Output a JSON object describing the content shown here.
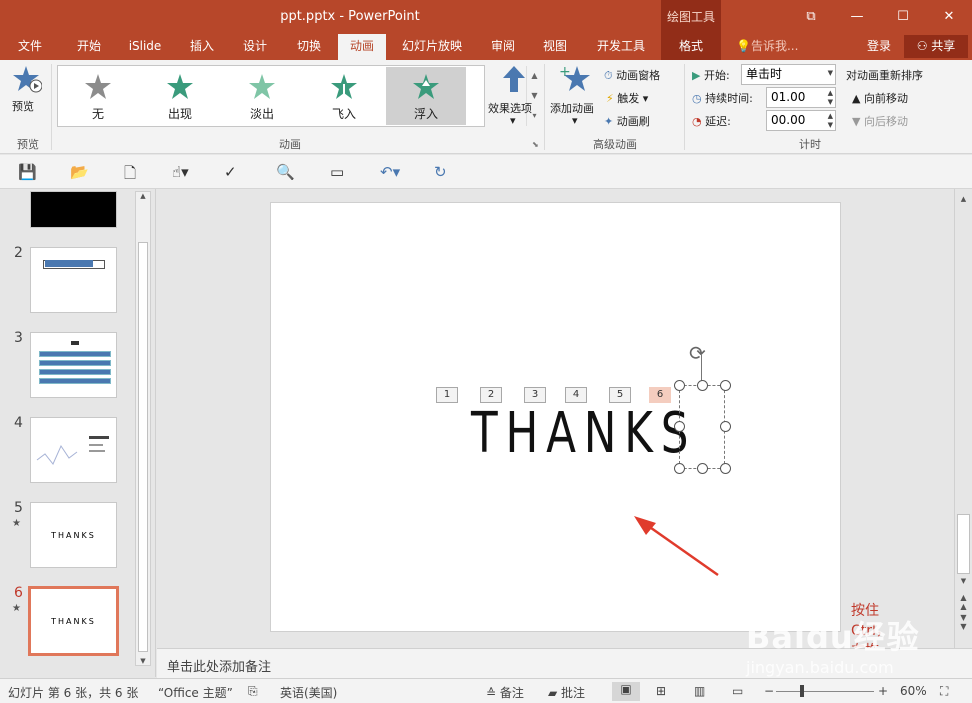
{
  "window": {
    "title": "ppt.pptx - PowerPoint",
    "context_tool": "绘图工具"
  },
  "tabs": [
    "文件",
    "开始",
    "iSlide",
    "插入",
    "设计",
    "切换",
    "动画",
    "幻灯片放映",
    "审阅",
    "视图",
    "开发工具",
    "格式"
  ],
  "tell_me": "告诉我...",
  "login": "登录",
  "share": "共享",
  "ribbon": {
    "preview_label": "预览",
    "preview_group": "预览",
    "animations": [
      "无",
      "出现",
      "淡出",
      "飞入",
      "浮入"
    ],
    "effect_options": "效果选项",
    "anim_group": "动画",
    "add_animation": "添加动画",
    "animation_pane": "动画窗格",
    "trigger": "触发",
    "animation_painter": "动画刷",
    "advanced_group": "高级动画",
    "start_label": "开始:",
    "start_value": "单击时",
    "duration_label": "持续时间:",
    "duration_value": "01.00",
    "delay_label": "延迟:",
    "delay_value": "00.00",
    "timing_group": "计时",
    "reorder_title": "对动画重新排序",
    "move_earlier": "向前移动",
    "move_later": "向后移动"
  },
  "thumbnails": [
    {
      "num": "2"
    },
    {
      "num": "3"
    },
    {
      "num": "4"
    },
    {
      "num": "5",
      "text": "THANKS"
    },
    {
      "num": "6",
      "text": "THANKS"
    }
  ],
  "slide": {
    "anim_markers": [
      "1",
      "2",
      "3",
      "4",
      "5",
      "6"
    ],
    "letters": "THANKS",
    "caption": "按住Ctrl，右拖拉"
  },
  "notes_placeholder": "单击此处添加备注",
  "status": {
    "slide_info": "幻灯片 第 6 张，共 6 张",
    "theme": "“Office 主题”",
    "language": "英语(美国)",
    "notes": "备注",
    "comments": "批注",
    "zoom": "60%"
  },
  "watermark": {
    "brand": "Baidu经验",
    "url": "jingyan.baidu.com"
  },
  "colors": {
    "accent": "#b7472a",
    "dark_accent": "#922d18",
    "marker_highlight": "#f4cdbf",
    "arrow": "#e03b2c"
  }
}
